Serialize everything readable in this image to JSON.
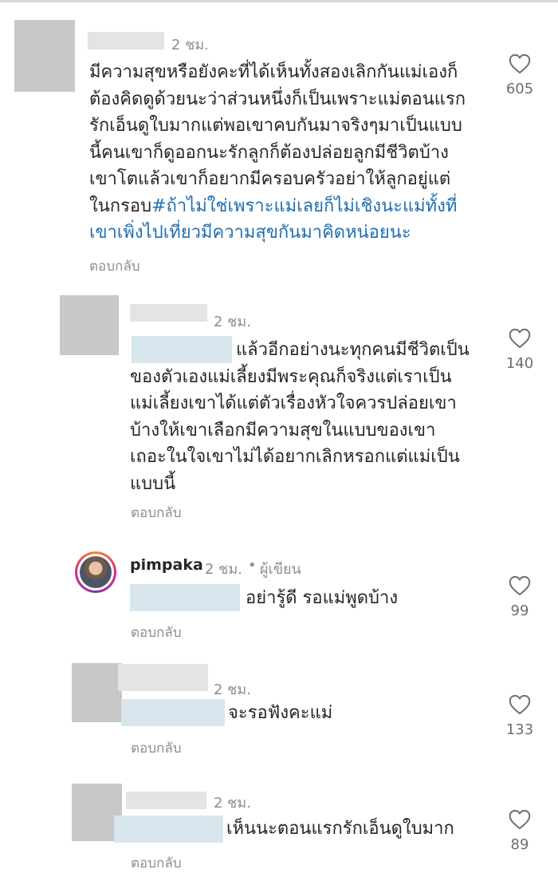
{
  "comments": [
    {
      "time": "2 ชม.",
      "lines": [
        "มีความสุขหรือยังคะที่ได้เห็นทั้งสองเลิกกันแม่เองก็",
        "ต้องคิดดูด้วยนะว่าส่วนหนึ่งก็เป็นเพราะแม่ตอนแรก",
        "รักเอ็นดูใบมากแต่พอเขาคบกันมาจริงๆมาเป็นแบบ",
        "นี้คนเขาก็ดูออกนะรักลูกก็ต้องปล่อยลูกมีชีวิตบ้าง",
        "เขาโตแล้วเขาก็อยากมีครอบครัวอย่าให้ลูกอยู่แต่"
      ],
      "line6_plain": "ในกรอบ",
      "line6_hashtag": "#ถ้าไม่ใช่เพราะแม่เลยก็ไม่เชิงนะแม่ทั้งที่",
      "line7_hashtag": "เขาเพิ่งไปเที่ยวมีความสุขกันมาคิดหน่อยนะ",
      "reply": "ตอบกลับ",
      "likes": "605"
    },
    {
      "time": "2 ชม.",
      "lines": [
        "แล้วอีกอย่างนะทุกคนมีชีวิตเป็น",
        "ของตัวเองแม่เลี้ยงมีพระคุณก็จริงแต่เราเป็น",
        "แม่เลี้ยงเขาได้แต่ตัวเรื่องหัวใจควรปล่อยเขา",
        "บ้างให้เขาเลือกมีความสุขในแบบของเขา",
        "เถอะในใจเขาไม่ได้อยากเลิกหรอกแต่แม่เป็น",
        "แบบนี้"
      ],
      "reply": "ตอบกลับ",
      "likes": "140"
    },
    {
      "username": "pimpaka",
      "time": "2 ชม.",
      "author_tag": "ผู้เขียน",
      "text": "อย่ารู้ดี รอแม่พูดบ้าง",
      "reply": "ตอบกลับ",
      "likes": "99"
    },
    {
      "time": "2 ชม.",
      "text": "จะรอฟังคะแม่",
      "reply": "ตอบกลับ",
      "likes": "133"
    },
    {
      "time": "2 ชม.",
      "text": "เห็นนะตอนแรกรักเอ็นดูใบมาก",
      "reply": "ตอบกลับ",
      "likes": "89"
    }
  ],
  "icons": {
    "like": "heart-outline-icon"
  },
  "colors": {
    "hashtag": "#1f6fb2",
    "muted": "#8e8e8e"
  }
}
